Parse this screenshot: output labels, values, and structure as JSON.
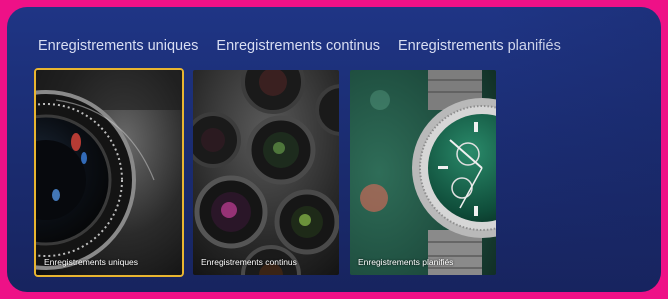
{
  "tabs": [
    {
      "label": "Enregistrements uniques"
    },
    {
      "label": "Enregistrements continus"
    },
    {
      "label": "Enregistrements planifiés"
    }
  ],
  "tiles": [
    {
      "label": "Enregistrements uniques",
      "selected": true,
      "image": "camera-lens-image"
    },
    {
      "label": "Enregistrements continus",
      "selected": false,
      "image": "camera-lenses-image"
    },
    {
      "label": "Enregistrements planifiés",
      "selected": false,
      "image": "wristwatch-image"
    }
  ],
  "colors": {
    "accent": "#e8b530",
    "background": "#1b2d73",
    "frame": "#ee1187"
  }
}
